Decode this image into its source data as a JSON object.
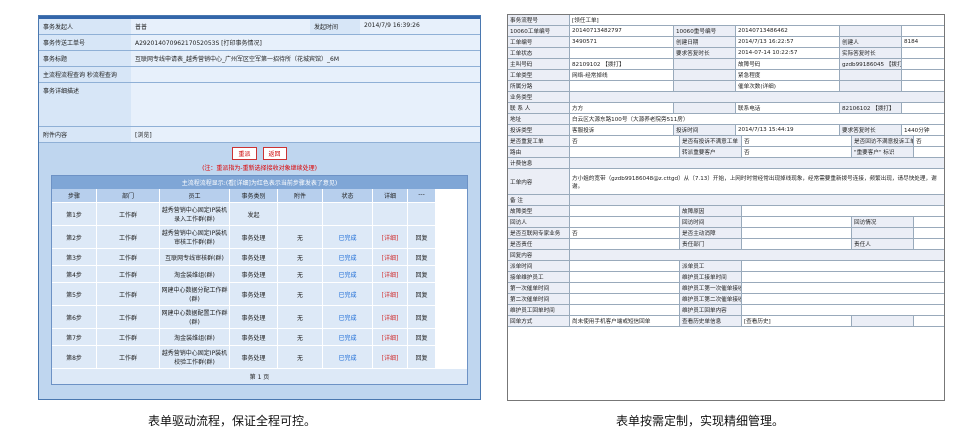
{
  "left": {
    "header": [
      {
        "k": "事务发起人",
        "v": "普普",
        "k2": "发起时间",
        "v2": "2014/7/9 16:39:26"
      },
      {
        "k": "事务传送工单号",
        "v": "A29201407096217052053S [打印事务情况]"
      },
      {
        "k": "事务标题",
        "v": "互联网专线申请表_越秀营销中心_广州军区空军第一招待所（花城宾馆）_6M"
      },
      {
        "k": "主流程流程查询 秒流程查询",
        "v": ""
      },
      {
        "k": "事务详细描述",
        "v": ""
      },
      {
        "k": "附件内容",
        "v": "[浏览]"
      }
    ],
    "btn_back": "重派",
    "btn_return": "返回",
    "note": "(注：重派指为-重新选择接收对象继续处理)",
    "table_title": "主流程流程显示:(看[详细]为红色表示当前步骤发表了意见)",
    "cols": [
      "步骤",
      "部门",
      "员工",
      "事务类别",
      "附件",
      "状态",
      "详细",
      "---"
    ],
    "rows": [
      [
        "第1步",
        "工作群",
        "越秀营销中心固定IP装机录入工作群(群)",
        "发起",
        "",
        "",
        "",
        ""
      ],
      [
        "第2步",
        "工作群",
        "越秀营销中心固定IP装机审核工作群(群)",
        "事务处理",
        "无",
        "已完成",
        "[详细]",
        "回复"
      ],
      [
        "第3步",
        "工作群",
        "互联网专线审核群(群)",
        "事务处理",
        "无",
        "已完成",
        "[详细]",
        "回复"
      ],
      [
        "第4步",
        "工作群",
        "淘金装维组(群)",
        "事务处理",
        "无",
        "已完成",
        "[详细]",
        "回复"
      ],
      [
        "第5步",
        "工作群",
        "网建中心数据分配工作群(群)",
        "事务处理",
        "无",
        "已完成",
        "[详细]",
        "回复"
      ],
      [
        "第6步",
        "工作群",
        "网建中心数据配置工作群(群)",
        "事务处理",
        "无",
        "已完成",
        "[详细]",
        "回复"
      ],
      [
        "第7步",
        "工作群",
        "淘金装维组(群)",
        "事务处理",
        "无",
        "已完成",
        "[详细]",
        "回复"
      ],
      [
        "第8步",
        "工作群",
        "越秀营销中心固定IP装机校验工作群(群)",
        "事务处理",
        "无",
        "已完成",
        "[详细]",
        "回复"
      ]
    ],
    "page": "第 1 页",
    "caption": "表单驱动流程，保证全程可控。"
  },
  "right": {
    "rows": [
      {
        "t": "c2",
        "c": [
          "事务流程号",
          "[领任工单]"
        ]
      },
      {
        "t": "c8",
        "c": [
          "10060工单编号",
          "20140713482797",
          "10060重号编号",
          "20140713486462",
          "",
          ""
        ]
      },
      {
        "t": "c8",
        "c": [
          "工单编号",
          "3490571",
          "创建日期",
          "2014/7/13 16:22:57",
          "创建人",
          "8184"
        ]
      },
      {
        "t": "c8",
        "c": [
          "工单状态",
          "",
          "要求答复时长",
          "2014-07-14 10:22:57",
          "实际答复时长",
          ""
        ]
      },
      {
        "t": "c8",
        "c": [
          "主叫号码",
          "82109102 【拨打】",
          "",
          "故障号码",
          "gzdb99186045 【拨打】",
          ""
        ]
      },
      {
        "t": "c8",
        "c": [
          "工单类型",
          "网络-经常掉线",
          "",
          "紧急程度",
          "",
          ""
        ]
      },
      {
        "t": "c8",
        "c": [
          "所属分路",
          "",
          "",
          "催单次数(详细)",
          "",
          ""
        ]
      },
      {
        "t": "c2",
        "c": [
          "业务类型",
          ""
        ]
      },
      {
        "t": "c8",
        "c": [
          "联 系 人",
          "方方",
          "",
          "联系电话",
          "82106102 【拨打】",
          ""
        ]
      },
      {
        "t": "c2",
        "c": [
          "地址",
          "白云区大源东路100号（大源养老院旁511房）"
        ]
      },
      {
        "t": "c8",
        "c": [
          "投诉类型",
          "客服投诉",
          "投诉时间",
          "2014/7/13 15:44:19",
          "要求答复时长",
          "1440分钟"
        ]
      },
      {
        "t": "c6",
        "c": [
          "是否重复工单",
          "否",
          "是否有投诉不满意工单",
          "否",
          "是否回访不满意投诉工单",
          "否"
        ]
      },
      {
        "t": "c6",
        "c": [
          "路由",
          "",
          "转派重要客户",
          "否",
          "\"重要客户\" 标识",
          ""
        ]
      },
      {
        "t": "c2",
        "c": [
          "计费信息",
          ""
        ]
      },
      {
        "t": "c2",
        "c": [
          "工单内容",
          "方小姐的宽带（gzdb99186048@z.cttgd）从（7.13）开始，上网时时常经常出现掉线现象，经常需要重新拨号连接，频繁出现，请尽快处理，谢谢。"
        ]
      },
      {
        "t": "c2",
        "c": [
          "备 注",
          ""
        ]
      },
      {
        "t": "c4",
        "c": [
          "故障类型",
          "",
          "故障原因",
          ""
        ]
      },
      {
        "t": "c6",
        "c": [
          "回访人",
          "",
          "回访时间",
          "",
          "回访情况",
          ""
        ]
      },
      {
        "t": "c6",
        "c": [
          "是否互联网专家业务",
          "否",
          "是否主动消障",
          "",
          "",
          ""
        ]
      },
      {
        "t": "c6",
        "c": [
          "是否责任",
          "",
          "责任部门",
          "",
          "责任人",
          ""
        ]
      },
      {
        "t": "c2",
        "c": [
          "回复内容",
          ""
        ]
      },
      {
        "t": "c4",
        "c": [
          "派单时间",
          "",
          "派单员工",
          ""
        ]
      },
      {
        "t": "c4",
        "c": [
          "接单维护员工",
          "",
          "维护员工接单时间",
          ""
        ]
      },
      {
        "t": "c4",
        "c": [
          "第一次催单时间",
          "",
          "维护员工第一次催单接收时间",
          ""
        ]
      },
      {
        "t": "c4",
        "c": [
          "第二次催单时间",
          "",
          "维护员工第二次催单接收时间",
          ""
        ]
      },
      {
        "t": "c4",
        "c": [
          "维护员工回单时间",
          "",
          "维护员工回单内容",
          ""
        ]
      },
      {
        "t": "c6",
        "c": [
          "回单方式",
          "尚未使用手机客户端或短信回单",
          "查看历史单信息",
          "[查看历史]",
          "",
          ""
        ]
      }
    ],
    "caption": "表单按需定制，实现精细管理。"
  },
  "colors": {
    "panel": "#bfd6ef",
    "header_strip": "#3366aa",
    "done": "#1a6ad6",
    "detail": "#d03030"
  }
}
